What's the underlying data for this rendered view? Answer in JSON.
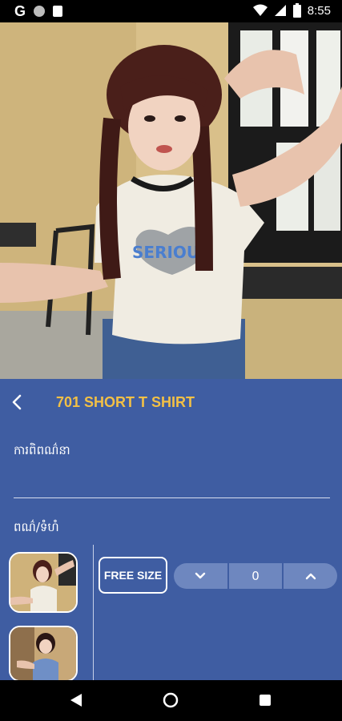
{
  "status_bar": {
    "time": "8:55",
    "app_letter": "G"
  },
  "hero": {
    "print_text": "SERIOUS"
  },
  "product": {
    "title": "701 SHORT T SHIRT",
    "description_label": "ការពិពណ៌នា",
    "color_size_label": "ពណ៌/ទំហំ"
  },
  "size": {
    "option": "FREE SIZE",
    "quantity": "0"
  },
  "colors": {
    "accent": "#f2c046",
    "panel": "#3f5da2",
    "stepper": "#6e87bf"
  },
  "icons": [
    "back-arrow-icon",
    "chevron-down-icon",
    "chevron-up-icon",
    "nav-back-icon",
    "nav-home-icon",
    "nav-recents-icon",
    "wifi-icon",
    "signal-icon",
    "battery-icon"
  ]
}
